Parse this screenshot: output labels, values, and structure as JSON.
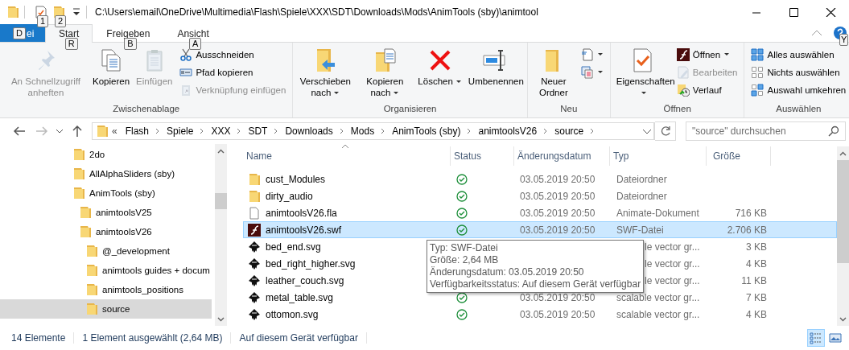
{
  "title_bar": {
    "quick_access_keytips": [
      "1",
      "2"
    ],
    "path": "C:\\Users\\email\\OneDrive\\Multimedia\\Flash\\Spiele\\XXX\\SDT\\Downloads\\Mods\\AnimTools (sby)\\animtool"
  },
  "ribbon": {
    "tabs": [
      {
        "label": "ei",
        "kind": "file",
        "keytip": "D",
        "selected": false
      },
      {
        "label": "Start",
        "kind": "tab",
        "keytip": "R",
        "selected": true
      },
      {
        "label": "Freigeben",
        "kind": "tab",
        "keytip": "B",
        "selected": false
      },
      {
        "label": "Ansicht",
        "kind": "tab",
        "keytip": "A",
        "selected": false
      }
    ],
    "help_keytip": "Y",
    "groups": [
      {
        "label": "Zwischenablage",
        "items": [
          {
            "kind": "large",
            "label": "An Schnellzugriff anheften",
            "disabled": true
          },
          {
            "kind": "large",
            "label": "Kopieren",
            "disabled": false
          },
          {
            "kind": "large",
            "label": "Einfügen",
            "disabled": true
          },
          {
            "kind": "stack",
            "commands": [
              {
                "label": "Ausschneiden",
                "disabled": false
              },
              {
                "label": "Pfad kopieren",
                "disabled": false
              },
              {
                "label": "Verknüpfung einfügen",
                "disabled": true
              }
            ]
          }
        ]
      },
      {
        "label": "Organisieren",
        "items": [
          {
            "kind": "large",
            "label": "Verschieben nach",
            "menu": true,
            "disabled": false
          },
          {
            "kind": "large",
            "label": "Kopieren nach",
            "menu": true,
            "disabled": false
          },
          {
            "kind": "large",
            "label": "Löschen",
            "menu": true,
            "disabled": false
          },
          {
            "kind": "large",
            "label": "Umbenennen",
            "disabled": false
          }
        ]
      },
      {
        "label": "Neu",
        "items": [
          {
            "kind": "large",
            "label": "Neuer Ordner",
            "disabled": false
          },
          {
            "kind": "stack",
            "commands": [
              {
                "menu": true,
                "disabled": false
              },
              {
                "menu": true,
                "disabled": false
              }
            ]
          }
        ]
      },
      {
        "label": "Öffnen",
        "items": [
          {
            "kind": "large",
            "label": "Eigenschaften",
            "menu": true,
            "disabled": false
          },
          {
            "kind": "stack",
            "commands": [
              {
                "label": "Öffnen",
                "menu": true,
                "disabled": false
              },
              {
                "label": "Bearbeiten",
                "disabled": true
              },
              {
                "label": "Verlauf",
                "disabled": false
              }
            ]
          }
        ]
      },
      {
        "label": "Auswählen",
        "items": [
          {
            "kind": "stack",
            "commands": [
              {
                "label": "Alles auswählen",
                "disabled": false
              },
              {
                "label": "Nichts auswählen",
                "disabled": false
              },
              {
                "label": "Auswahl umkehren",
                "disabled": false
              }
            ]
          }
        ]
      }
    ]
  },
  "address_bar": {
    "overflow": "«",
    "crumbs": [
      "Flash",
      "Spiele",
      "XXX",
      "SDT",
      "Downloads",
      "Mods",
      "AnimTools (sby)",
      "animtoolsV26",
      "source"
    ],
    "search_placeholder": "\"source\" durchsuchen"
  },
  "sidebar": {
    "items": [
      {
        "label": "2do",
        "selected": false
      },
      {
        "label": "AllAlphaSliders (sby)",
        "selected": false
      },
      {
        "label": "AnimTools (sby)",
        "selected": false,
        "children": [
          {
            "label": "animtoolsV25",
            "selected": false
          },
          {
            "label": "animtoolsV26",
            "selected": false,
            "children": [
              {
                "label": "@_development",
                "selected": false
              },
              {
                "label": "animtools guides + docum",
                "selected": false
              },
              {
                "label": "animtools_positions",
                "selected": false
              },
              {
                "label": "source",
                "selected": true
              }
            ]
          }
        ]
      }
    ]
  },
  "files": {
    "columns": [
      "Name",
      "Status",
      "Änderungsdatum",
      "Typ",
      "Größe"
    ],
    "rows": [
      {
        "kind": "folder",
        "name": "cust_Modules",
        "synced": true,
        "date": "03.05.2019 20:50",
        "type": "Dateiordner",
        "selected": false
      },
      {
        "kind": "folder",
        "name": "dirty_audio",
        "synced": true,
        "date": "03.05.2019 20:50",
        "type": "Dateiordner",
        "selected": false
      },
      {
        "kind": "document",
        "name": "animtoolsV26.fla",
        "synced": true,
        "date": "03.05.2019 20:50",
        "type": "Animate-Dokument",
        "size": "716 KB",
        "selected": false
      },
      {
        "kind": "flash",
        "name": "animtoolsV26.swf",
        "synced": true,
        "date": "03.05.2019 20:50",
        "type": "SWF-Datei",
        "size": "2.706 KB",
        "selected": true
      },
      {
        "kind": "vector",
        "name": "bed_end.svg",
        "type_partial": "le vector gr...",
        "size": "3 KB",
        "selected": false
      },
      {
        "kind": "vector",
        "name": "bed_right_higher.svg",
        "type_partial": "le vector gr...",
        "size": "4 KB",
        "selected": false
      },
      {
        "kind": "vector",
        "name": "leather_couch.svg",
        "type_partial": "le vector gr...",
        "size": "11 KB",
        "selected": false
      },
      {
        "kind": "vector",
        "name": "metal_table.svg",
        "synced": true,
        "date": "03.05.2019 20:50",
        "type": "scalable vector gr...",
        "size": "7 KB",
        "selected": false
      },
      {
        "kind": "vector",
        "name": "ottomon.svg",
        "synced": true,
        "date": "03.05.2019 20:50",
        "type": "scalable vector gr...",
        "size": "4 KB",
        "selected": false
      }
    ]
  },
  "tooltip": {
    "lines": [
      "Typ: SWF-Datei",
      "Größe: 2,64 MB",
      "Änderungsdatum: 03.05.2019 20:50",
      "Verfügbarkeitsstatus: Auf diesem Gerät verfügbar"
    ]
  },
  "status_bar": {
    "texts": [
      "14 Elemente",
      "1 Element ausgewählt (2,64 MB)",
      "Auf diesem Gerät verfügbar"
    ],
    "views": [
      {
        "kind": "details",
        "selected": true
      },
      {
        "kind": "large-icons",
        "selected": false
      }
    ]
  }
}
